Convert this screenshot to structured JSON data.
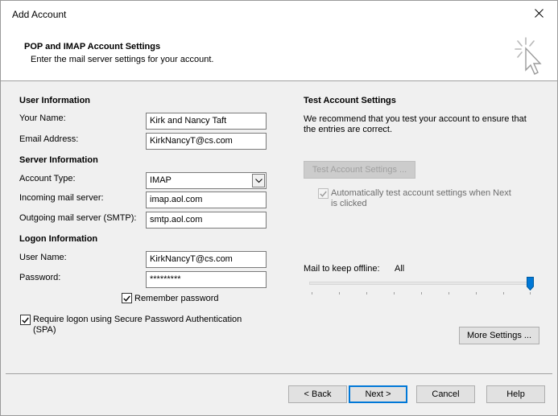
{
  "window": {
    "title": "Add Account",
    "close_icon": "close-icon"
  },
  "header": {
    "title": "POP and IMAP Account Settings",
    "subtitle": "Enter the mail server settings for your account.",
    "icon": "wizard-cursor-icon"
  },
  "user_info": {
    "section": "User Information",
    "name_label": "Your Name:",
    "name_value": "Kirk and  Nancy Taft",
    "email_label": "Email Address:",
    "email_value": "KirkNancyT@cs.com"
  },
  "server_info": {
    "section": "Server Information",
    "account_type_label": "Account Type:",
    "account_type_value": "IMAP",
    "incoming_label": "Incoming mail server:",
    "incoming_value": "imap.aol.com",
    "outgoing_label": "Outgoing mail server (SMTP):",
    "outgoing_value": "smtp.aol.com"
  },
  "logon_info": {
    "section": "Logon Information",
    "username_label": "User Name:",
    "username_value": "KirkNancyT@cs.com",
    "password_label": "Password:",
    "password_value": "*********",
    "remember_label": "Remember password",
    "remember_checked": true,
    "spa_label_line1": "Require logon using Secure Password Authentication",
    "spa_label_line2": "(SPA)",
    "spa_checked": true
  },
  "test_settings": {
    "section": "Test Account Settings",
    "desc_line1": "We recommend that you test your account to ensure that",
    "desc_line2": "the entries are correct.",
    "test_button": "Test Account Settings ...",
    "auto_test_line1": "Automatically test account settings when Next",
    "auto_test_line2": "is clicked",
    "auto_test_checked": true
  },
  "offline": {
    "label": "Mail to keep offline:",
    "value": "All",
    "slider_level": 1.0
  },
  "buttons": {
    "more_settings": "More Settings ...",
    "back": "< Back",
    "next": "Next >",
    "cancel": "Cancel",
    "help": "Help"
  },
  "colors": {
    "accent": "#0078d7",
    "window_bg": "#f0f0f0",
    "header_bg": "#ffffff"
  }
}
